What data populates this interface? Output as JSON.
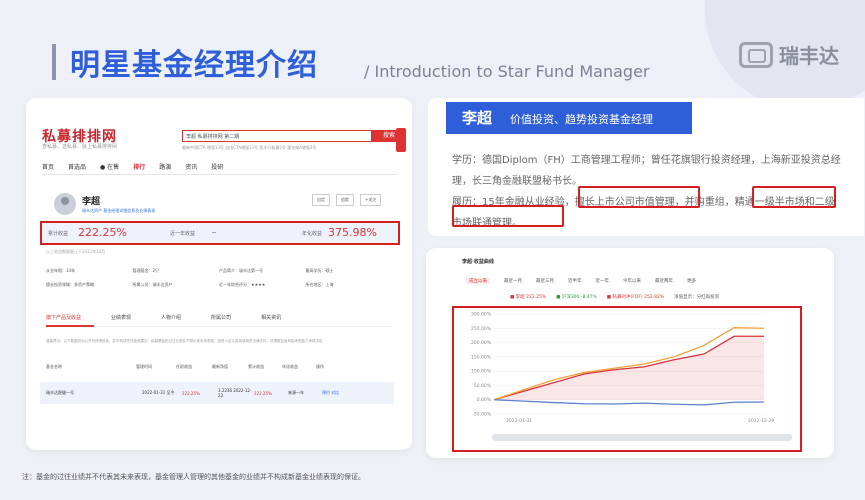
{
  "header": {
    "title": "明星基金经理介绍",
    "subtitle": "/ Introduction to Star Fund Manager",
    "logo_text": "瑞丰达"
  },
  "screenshot": {
    "site_logo": "私募排排网",
    "site_tagline": "查私募、选私募、就上私募排排网",
    "search_value": "李超 私募排排网 第二期",
    "search_button": "搜索",
    "hot_words": "最新中国CTA 增强13号  自由CTA增强13号  凯丰行私募2号  量化纯A增强3号",
    "nav": [
      "首页",
      "首选品",
      "● 在售",
      "排行",
      "路演",
      "资讯",
      "投研"
    ],
    "manager_name": "李超",
    "manager_tag": "瑞丰达资产  基金经理详细信息及业绩表现",
    "buttons": [
      "自定",
      "追踪",
      "+关注"
    ],
    "returns": {
      "label1": "累计收益",
      "value1": "222.25%",
      "label2": "近一年收益",
      "value2": "--",
      "label3": "年化收益",
      "value3": "375.98%"
    },
    "since": "以上收益数据截止于2022年12月",
    "info": [
      "从业年限：14年",
      "管理基金：2只",
      "产品简介：瑞丰达第一号",
      "最高学历：硕士",
      "擅长投资领域：多资产策略",
      "所属公司：瑞丰达资产",
      "近一年综合评分：★★★★",
      "所在地区：上海"
    ],
    "tabs": [
      "旗下产品及收益",
      "业绩表现",
      "人物介绍",
      "所属公司",
      "相关资讯"
    ],
    "note": "温馨提示：以下数据均为公开可获得信息，并不构成任何投资建议；私募基金的过往业绩并不预示其未来表现，投资人应认真阅读相关法律文件，并根据自身风险承受能力审慎决定。",
    "table_header": [
      "基金名称",
      "管理时间",
      "任职收益",
      "最新净值",
      "累计收益",
      "年化收益",
      "操作"
    ],
    "table_row": [
      "瑞丰达稳健一号",
      "2022-01-31 至今",
      "222.25%",
      "3.2236 2022-12-23",
      "222.25%",
      "来源一年",
      "预约  对比"
    ]
  },
  "bio": {
    "name": "李超",
    "role": "价值投资、趋势投资基金经理",
    "line1": "学历：德国Diplom（FH）工商管理工程师；曾任花旗银行投资经理，上海新亚投资总经理，长三角金融联盟秘书长。",
    "line2": "履历：15年金融从业经验，擅长上市公司市值管理，并购重组，精通一级半市场和二级市场联通管理。"
  },
  "chart_card": {
    "title": "李超·收益曲线",
    "periods": [
      "成立以来",
      "最近一月",
      "最近三月",
      "近半年",
      "近一年",
      "今年以来",
      "最近两年",
      "更多"
    ],
    "legend": [
      "■ 李超  222.25%",
      "■ 沪深300  -8.47%",
      "■ 私募对冲(FOF)  252.82%",
      "净值显示：分红再投资"
    ]
  },
  "chart_data": {
    "type": "line",
    "x": [
      "2022-01-31",
      "2022-12-29"
    ],
    "ylim": [
      -50,
      300
    ],
    "ticks": [
      "300.00%",
      "250.00%",
      "200.00%",
      "150.00%",
      "100.00%",
      "50.00%",
      "0.00%",
      "-50.00%"
    ],
    "series": [
      {
        "name": "李超",
        "color": "#d6343b",
        "values": [
          0,
          30,
          60,
          90,
          105,
          115,
          140,
          160,
          222,
          222
        ]
      },
      {
        "name": "私募对冲(FOF)",
        "color": "#f0a23a",
        "values": [
          0,
          35,
          70,
          95,
          110,
          125,
          150,
          190,
          252,
          250
        ]
      },
      {
        "name": "沪深300",
        "color": "#5b7fc9",
        "values": [
          0,
          -5,
          -10,
          -14,
          -15,
          -12,
          -16,
          -18,
          -9,
          -8
        ]
      }
    ]
  },
  "footnote": "注：基金的过往业绩并不代表其未来表现，基金管理人管理的其他基金的业绩并不构成新基金业绩表现的保证。"
}
